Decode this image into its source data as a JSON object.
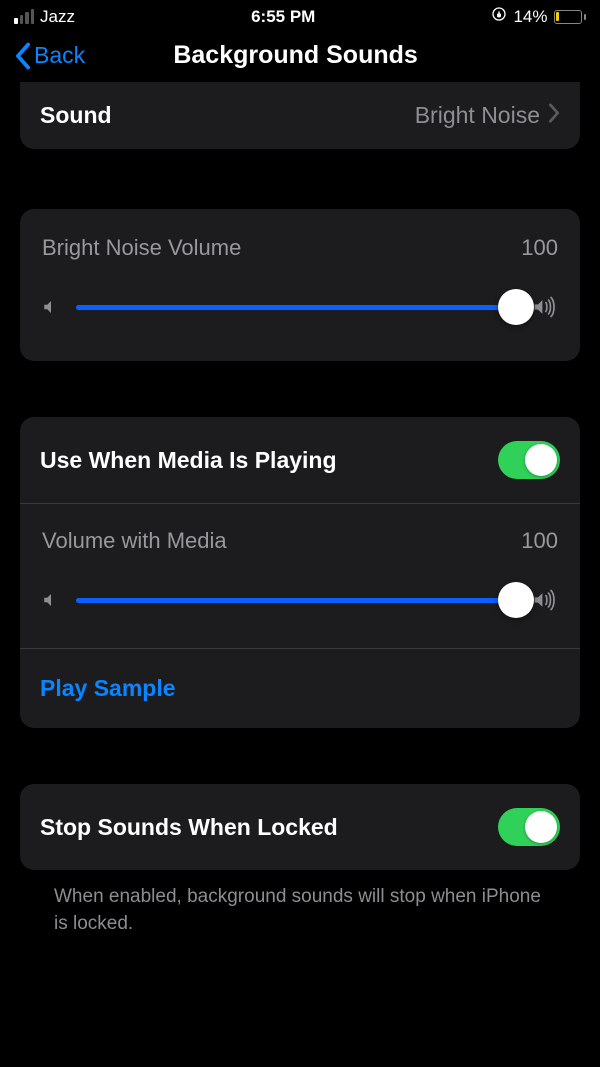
{
  "status": {
    "carrier": "Jazz",
    "time": "6:55 PM",
    "battery_pct": "14%"
  },
  "nav": {
    "back": "Back",
    "title": "Background Sounds"
  },
  "sound_row": {
    "label": "Sound",
    "value": "Bright Noise"
  },
  "volume_card": {
    "label": "Bright Noise Volume",
    "value": "100",
    "slider_pct": 100
  },
  "media_group": {
    "toggle_label": "Use When Media Is Playing",
    "toggle_on": true,
    "sub_label": "Volume with Media",
    "sub_value": "100",
    "sub_slider_pct": 100,
    "play_sample": "Play Sample"
  },
  "lock_group": {
    "toggle_label": "Stop Sounds When Locked",
    "toggle_on": true,
    "footnote": "When enabled, background sounds will stop when iPhone is locked."
  }
}
